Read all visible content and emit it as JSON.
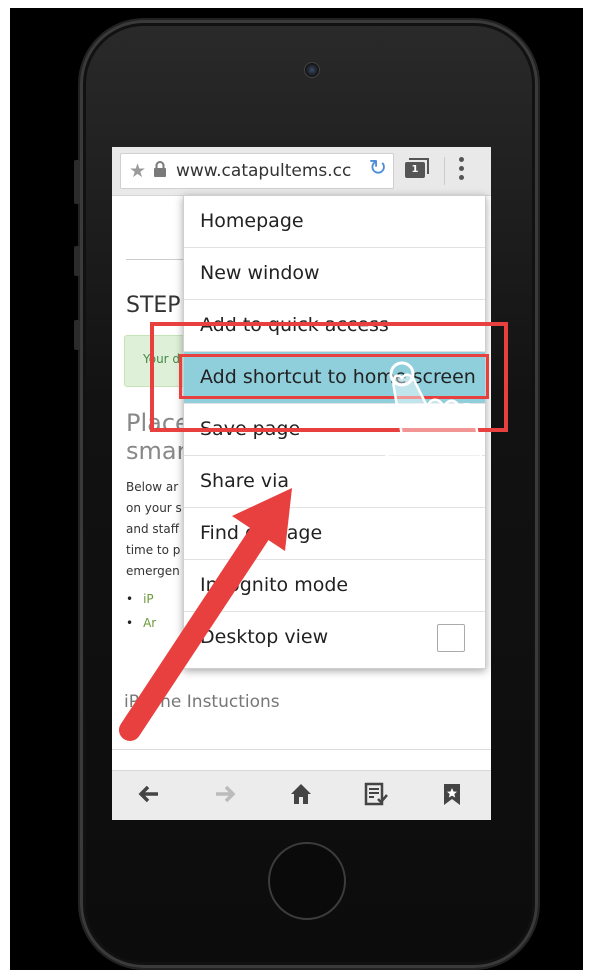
{
  "browser": {
    "url": "www.catapultems.cc",
    "tab_count": "1",
    "icons": {
      "bookmark": "star-icon",
      "security": "lock-icon",
      "reload": "reload-icon",
      "tabs": "tabs-icon",
      "menu": "overflow-menu-icon"
    }
  },
  "page": {
    "step_heading": "STEP",
    "alert_text": "Your d",
    "place_heading_line1": "Place",
    "place_heading_line2": "smar",
    "body_lines": [
      "Below ar",
      "on your s",
      "and staff",
      "time to p",
      "emergen"
    ],
    "bullets": [
      "iP",
      "Ar"
    ],
    "iphone_instructions": "iPhone Instuctions"
  },
  "menu": {
    "items": [
      {
        "label": "Homepage"
      },
      {
        "label": "New window"
      },
      {
        "label": "Add to quick access"
      },
      {
        "label": "Add shortcut to home screen",
        "highlighted": true
      },
      {
        "label": "Save page"
      },
      {
        "label": "Share via"
      },
      {
        "label": "Find on page"
      },
      {
        "label": "Incognito mode"
      },
      {
        "label": "Desktop view",
        "checkbox": false
      }
    ]
  },
  "bottom_bar": {
    "icons": [
      "back-arrow-icon",
      "forward-arrow-icon",
      "home-icon",
      "reading-list-icon",
      "bookmarks-icon"
    ]
  },
  "annotations": {
    "highlight_color": "#e8403f",
    "arrow_color": "#e8403f",
    "menu_highlight_color": "#8fcfdc"
  }
}
